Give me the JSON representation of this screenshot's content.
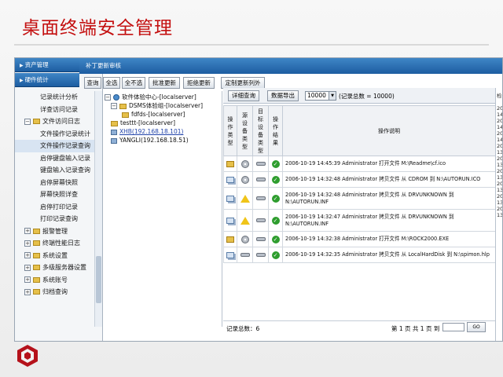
{
  "slide": {
    "title": "桌面终端安全管理"
  },
  "nav": {
    "header_1": "资产管理",
    "header_2": "硬件统计",
    "items": [
      {
        "label": "记录统计分析"
      },
      {
        "label": "详查访问记录"
      },
      {
        "label": "文件访问日志"
      },
      {
        "label": "文件操作记录统计"
      },
      {
        "label": "文件操作记录查询"
      },
      {
        "label": "启停键盘输入记录"
      },
      {
        "label": "键盘输入记录查询"
      },
      {
        "label": "启停屏幕快照"
      },
      {
        "label": "屏幕快照详查"
      },
      {
        "label": "启停打印记录"
      },
      {
        "label": "打印记录查询"
      },
      {
        "label": "报警管理"
      },
      {
        "label": "终端性能日志"
      },
      {
        "label": "系统设置"
      },
      {
        "label": "多级服务器设置"
      },
      {
        "label": "系统账号"
      },
      {
        "label": "归档查询"
      }
    ]
  },
  "topbar": {
    "title": "补丁更新审核"
  },
  "toolbar": {
    "buttons": [
      "查询",
      "全选",
      "全不选",
      "批准更新",
      "拒绝更新",
      "定制更新列外"
    ]
  },
  "tree": {
    "items": [
      "软件体验中心-[localserver]",
      "DSMS体验组-[localserver]",
      "fdfds-[localserver]",
      "testtt-[localserver]",
      "XHB(192.168.18.101)",
      "YANGLI(192.168.18.51)"
    ]
  },
  "right": {
    "detail_btn": "详细查询",
    "export_btn": "数据导出",
    "page_size": "10000",
    "total_text": "(记录总数 = 10000)",
    "headers": [
      "操作类型",
      "源设备类型",
      "目标设备类型",
      "操作结果",
      "操作说明"
    ],
    "rows": [
      {
        "op": "folder",
        "src": "cd",
        "dst": "disk",
        "desc": "2006-10-19 14:45:39 Administrator 打开文件 M:\\Readme\\cf.ico"
      },
      {
        "op": "copy",
        "src": "cd",
        "dst": "disk",
        "desc": "2006-10-19 14:32:48 Administrator 拷贝文件 从 CDROM 到 N:\\AUTORUN.ICO"
      },
      {
        "op": "copy",
        "src": "warn",
        "dst": "disk",
        "desc": "2006-10-19 14:32:48 Administrator 拷贝文件 从 DRVUNKNOWN 到 N:\\AUTORUN.INF"
      },
      {
        "op": "copy",
        "src": "warn",
        "dst": "disk",
        "desc": "2006-10-19 14:32:47 Administrator 拷贝文件 从 DRVUNKNOWN 到 N:\\AUTORUN.INF"
      },
      {
        "op": "folder",
        "src": "cd",
        "dst": "disk",
        "desc": "2006-10-19 14:32:38 Administrator 打开文件 M:\\ROCK2000.EXE"
      },
      {
        "op": "copy",
        "src": "disk",
        "dst": "disk",
        "desc": "2006-10-19 14:32:35 Administrator 拷贝文件 从 LocalHardDisk 到 N:\\spimon.hlp"
      }
    ],
    "record_count": "记录总数：6",
    "pager": "第 1 页 共 1 页 到",
    "go_label": "GO"
  },
  "edge": {
    "col_header": "检",
    "texts": [
      "2007-",
      "14:36",
      "2007-",
      "14:36",
      "2007-",
      "14:36",
      "2007-",
      "13:05",
      "2007-",
      "13:05",
      "2007-",
      "13:05",
      "2007-",
      "13:05",
      "2007-",
      "13:05",
      "2007-",
      "13:05"
    ]
  },
  "colors": {
    "title": "#c41010",
    "header_blue": "#1d5da1",
    "ok_green": "#2e9d2e",
    "logo_red": "#b5121b"
  }
}
